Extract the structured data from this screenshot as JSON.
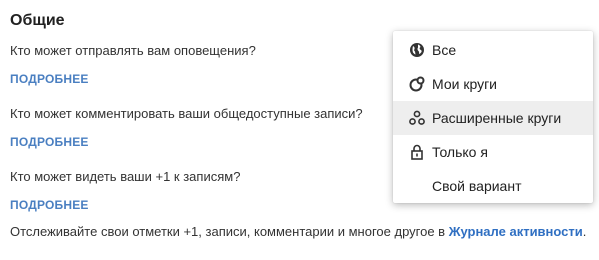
{
  "section": {
    "title": "Общие"
  },
  "settings": [
    {
      "question": "Кто может отправлять вам оповещения?",
      "link": "ПОДРОБНЕЕ"
    },
    {
      "question": "Кто может комментировать ваши общедоступные записи?",
      "link": "ПОДРОБНЕЕ"
    },
    {
      "question": "Кто может видеть ваши +1 к записям?",
      "link": "ПОДРОБНЕЕ"
    }
  ],
  "footer": {
    "text": "Отслеживайте свои отметки +1, записи, комментарии и многое другое в ",
    "link": "Журнале активности",
    "end": "."
  },
  "menu": {
    "highlighted_item": "Расширенные круги",
    "items": [
      {
        "label": "Все",
        "icon": "globe-icon"
      },
      {
        "label": "Мои круги",
        "icon": "circles-icon"
      },
      {
        "label": "Расширенные круги",
        "icon": "extended-circles-icon"
      },
      {
        "label": "Только я",
        "icon": "lock-icon"
      },
      {
        "label": "Свой вариант",
        "icon": ""
      }
    ]
  },
  "colors": {
    "link": "#4a7fc1",
    "activity_link": "#2f6fc2",
    "menu_hover": "#eeeeee"
  }
}
